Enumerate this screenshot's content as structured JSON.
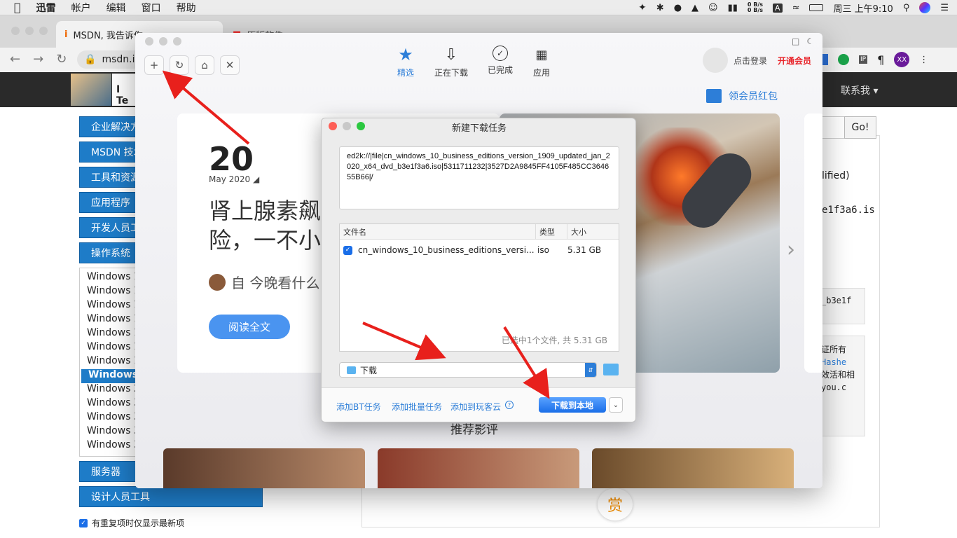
{
  "menubar": {
    "items": [
      "迅雷",
      "帐户",
      "编辑",
      "窗口",
      "帮助"
    ],
    "net_speed_up": "0 B/s",
    "net_speed_down": "0 B/s",
    "input_method": "A",
    "clock": "周三 上午9:10"
  },
  "browser": {
    "tabs": [
      {
        "label": "MSDN, 我告诉你"
      },
      {
        "label": "原版软件"
      }
    ],
    "url": "msdn.itellyou.cn",
    "profile_initials": "XX"
  },
  "site": {
    "header_title": "I Te",
    "contact_me": "联系我",
    "search_go": "Go!",
    "categories_top": [
      "企业解决方",
      "MSDN 技术",
      "工具和资源",
      "应用程序",
      "开发人员工",
      "操作系统"
    ],
    "windows_items": [
      "Windows 1",
      "Windows 1",
      "Windows 1",
      "Windows 1",
      "Windows 1",
      "Windows 1",
      "Windows 1",
      "Windows",
      "Windows 2",
      "Windows 3",
      "Windows 3",
      "Windows 3",
      "Windows 3"
    ],
    "categories_bottom": [
      "服务器",
      "设计人员工具"
    ],
    "checkbox_label": "有重复项时仅显示最新项",
    "right_texts": [
      "lified)",
      "e1f3a6.is",
      "_b3e1f",
      "证所有",
      "Hashe",
      "效活和相",
      "you.c"
    ],
    "reward_char": "赏"
  },
  "xunlei": {
    "nav": [
      {
        "label": "精选",
        "active": true,
        "icon": "star-icon"
      },
      {
        "label": "正在下载",
        "active": false,
        "icon": "download-icon"
      },
      {
        "label": "已完成",
        "active": false,
        "icon": "check-circle-icon"
      },
      {
        "label": "应用",
        "active": false,
        "icon": "apps-icon"
      }
    ],
    "login": "点击登录",
    "vip": "开通会员",
    "red_packet": "领会员红包",
    "day": "20",
    "month": "May 2020",
    "headline_1": "肾上腺素飙",
    "headline_2": "险，一不小",
    "author_line": "自  今晚看什么",
    "read_more": "阅读全文",
    "recommend_title": "推荐影评"
  },
  "dialog": {
    "title": "新建下载任务",
    "link": "ed2k://|file|cn_windows_10_business_editions_version_1909_updated_jan_2020_x64_dvd_b3e1f3a6.iso|5311711232|3527D2A9845FF4105F485CC364655B66|/",
    "col_name": "文件名",
    "col_type": "类型",
    "col_size": "大小",
    "file_name": "cn_windows_10_business_editions_versi...",
    "file_type": "iso",
    "file_size": "5.31 GB",
    "summary": "已选中1个文件, 共 5.31 GB",
    "path": "下载",
    "add_bt": "添加BT任务",
    "add_batch": "添加批量任务",
    "add_cloud": "添加到玩客云",
    "download_btn": "下载到本地"
  },
  "colors": {
    "accent_blue": "#1a6ee8",
    "vip_red": "#e8262c",
    "site_blue": "#1e7cc8",
    "arrow_red": "#e8201c"
  }
}
